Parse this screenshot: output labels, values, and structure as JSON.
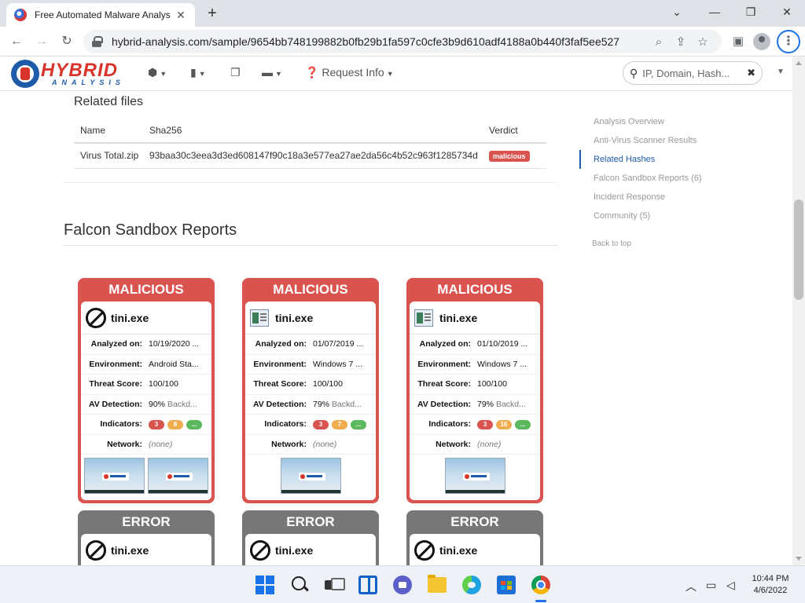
{
  "browser": {
    "tab_title": "Free Automated Malware Analys",
    "new_tab": "+",
    "minimize": "⌄",
    "restore": "—",
    "maximize": "❐",
    "close": "✕",
    "url": "hybrid-analysis.com/sample/9654bb748199882b0fb29b1fa597c0cfe3b9d610adf4188a0b440f3faf5ee527"
  },
  "site": {
    "logo_word": "HYBRID",
    "logo_sub": "ANALYSIS",
    "nav_request_info": "Request Info",
    "search_placeholder": "IP, Domain, Hash..."
  },
  "related_files": {
    "title": "Related files",
    "columns": [
      "Name",
      "Sha256",
      "Verdict"
    ],
    "rows": [
      {
        "name": "Virus Total.zip",
        "sha256": "93baa30c3eea3d3ed608147f90c18a3e577ea27ae2da56c4b52c963f1285734d",
        "verdict": "malicious"
      }
    ]
  },
  "falcon": {
    "title": "Falcon Sandbox Reports",
    "labels": {
      "analyzed": "Analyzed on:",
      "environment": "Environment:",
      "threat": "Threat Score:",
      "av": "AV Detection:",
      "indicators": "Indicators:",
      "network": "Network:"
    },
    "reports": [
      {
        "verdict": "MALICIOUS",
        "file": "tini.exe",
        "icon": "no-icon",
        "analyzed": "10/19/2020 ...",
        "environment": "Android Sta...",
        "threat": "100/100",
        "av_pct": "90%",
        "av_name": "Backd...",
        "ind": [
          "3",
          "8",
          "..."
        ],
        "network": "(none)",
        "shots": 2
      },
      {
        "verdict": "MALICIOUS",
        "file": "tini.exe",
        "icon": "windows-app-icon",
        "analyzed": "01/07/2019 ...",
        "environment": "Windows 7 ...",
        "threat": "100/100",
        "av_pct": "79%",
        "av_name": "Backd...",
        "ind": [
          "3",
          "7",
          "..."
        ],
        "network": "(none)",
        "shots": 1
      },
      {
        "verdict": "MALICIOUS",
        "file": "tini.exe",
        "icon": "windows-app-icon",
        "analyzed": "01/10/2019 ...",
        "environment": "Windows 7 ...",
        "threat": "100/100",
        "av_pct": "79%",
        "av_name": "Backd...",
        "ind": [
          "3",
          "16",
          "..."
        ],
        "network": "(none)",
        "shots": 1
      },
      {
        "verdict": "ERROR",
        "file": "tini.exe"
      },
      {
        "verdict": "ERROR",
        "file": "tini.exe"
      },
      {
        "verdict": "ERROR",
        "file": "tini.exe"
      }
    ]
  },
  "sidenav": {
    "items": [
      "Analysis Overview",
      "Anti-Virus Scanner Results",
      "Related Hashes",
      "Falcon Sandbox Reports (6)",
      "Incident Response",
      "Community (5)"
    ],
    "active_index": 2,
    "back": "Back to top"
  },
  "taskbar": {
    "time": "10:44 PM",
    "date": "4/6/2022"
  },
  "colors": {
    "malicious": "#d9534f",
    "error": "#777777",
    "brand_blue": "#1e5ba8",
    "brand_red": "#d9342b"
  }
}
